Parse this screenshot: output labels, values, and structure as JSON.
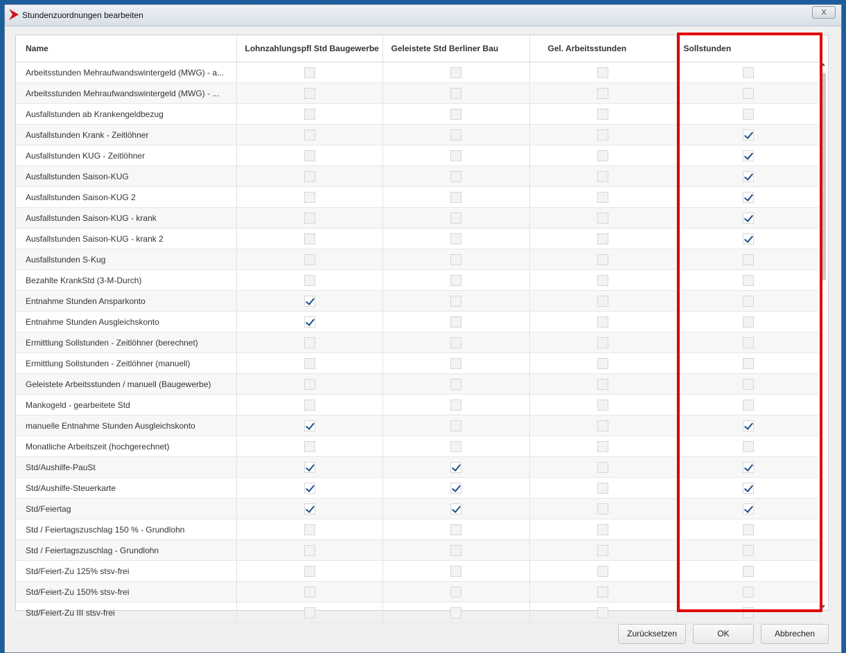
{
  "window": {
    "title": "Stundenzuordnungen bearbeiten",
    "close_label": "X"
  },
  "table": {
    "headers": [
      "Name",
      "Lohnzahlungspfl Std Baugewerbe",
      "Geleistete Std Berliner Bau",
      "Gel. Arbeitsstunden",
      "Sollstunden"
    ],
    "rows": [
      {
        "name": "Arbeitsstunden Mehraufwandswintergeld (MWG) - a...",
        "checks": [
          false,
          false,
          false,
          false
        ]
      },
      {
        "name": "Arbeitsstunden Mehraufwandswintergeld (MWG) - ...",
        "checks": [
          false,
          false,
          false,
          false
        ]
      },
      {
        "name": "Ausfallstunden ab Krankengeldbezug",
        "checks": [
          false,
          false,
          false,
          false
        ]
      },
      {
        "name": "Ausfallstunden Krank - Zeitlöhner",
        "checks": [
          false,
          false,
          false,
          true
        ]
      },
      {
        "name": "Ausfallstunden KUG - Zeitlöhner",
        "checks": [
          false,
          false,
          false,
          true
        ]
      },
      {
        "name": "Ausfallstunden Saison-KUG",
        "checks": [
          false,
          false,
          false,
          true
        ]
      },
      {
        "name": "Ausfallstunden Saison-KUG 2",
        "checks": [
          false,
          false,
          false,
          true
        ]
      },
      {
        "name": "Ausfallstunden Saison-KUG - krank",
        "checks": [
          false,
          false,
          false,
          true
        ]
      },
      {
        "name": "Ausfallstunden Saison-KUG - krank 2",
        "checks": [
          false,
          false,
          false,
          true
        ]
      },
      {
        "name": "Ausfallstunden S-Kug",
        "checks": [
          false,
          false,
          false,
          false
        ]
      },
      {
        "name": "Bezahlte KrankStd (3-M-Durch)",
        "checks": [
          false,
          false,
          false,
          false
        ]
      },
      {
        "name": "Entnahme Stunden Ansparkonto",
        "checks": [
          true,
          false,
          false,
          false
        ]
      },
      {
        "name": "Entnahme Stunden Ausgleichskonto",
        "checks": [
          true,
          false,
          false,
          false
        ]
      },
      {
        "name": "Ermittlung Sollstunden - Zeitlöhner (berechnet)",
        "checks": [
          false,
          false,
          false,
          false
        ]
      },
      {
        "name": "Ermittlung Sollstunden - Zeitlöhner (manuell)",
        "checks": [
          false,
          false,
          false,
          false
        ]
      },
      {
        "name": "Geleistete Arbeitsstunden / manuell (Baugewerbe)",
        "checks": [
          false,
          false,
          false,
          false
        ]
      },
      {
        "name": "Mankogeld - gearbeitete Std",
        "checks": [
          false,
          false,
          false,
          false
        ]
      },
      {
        "name": "manuelle Entnahme Stunden Ausgleichskonto",
        "checks": [
          true,
          false,
          false,
          true
        ]
      },
      {
        "name": "Monatliche Arbeitszeit (hochgerechnet)",
        "checks": [
          false,
          false,
          false,
          false
        ]
      },
      {
        "name": "Std/Aushilfe-PauSt",
        "checks": [
          true,
          true,
          false,
          true
        ]
      },
      {
        "name": "Std/Aushilfe-Steuerkarte",
        "checks": [
          true,
          true,
          false,
          true
        ]
      },
      {
        "name": "Std/Feiertag",
        "checks": [
          true,
          true,
          false,
          true
        ]
      },
      {
        "name": "Std / Feiertagszuschlag 150 % - Grundlohn",
        "checks": [
          false,
          false,
          false,
          false
        ]
      },
      {
        "name": "Std / Feiertagszuschlag - Grundlohn",
        "checks": [
          false,
          false,
          false,
          false
        ]
      },
      {
        "name": "Std/Feiert-Zu 125% stsv-frei",
        "checks": [
          false,
          false,
          false,
          false
        ]
      },
      {
        "name": "Std/Feiert-Zu 150% stsv-frei",
        "checks": [
          false,
          false,
          false,
          false
        ]
      },
      {
        "name": "Std/Feiert-Zu III stsv-frei",
        "checks": [
          false,
          false,
          false,
          false
        ]
      }
    ]
  },
  "scrollbar": {
    "position_fraction": 0.0
  },
  "buttons": {
    "reset": "Zurücksetzen",
    "ok": "OK",
    "cancel": "Abbrechen"
  },
  "colors": {
    "highlight": "#e00000",
    "check": "#1f4e8c"
  }
}
